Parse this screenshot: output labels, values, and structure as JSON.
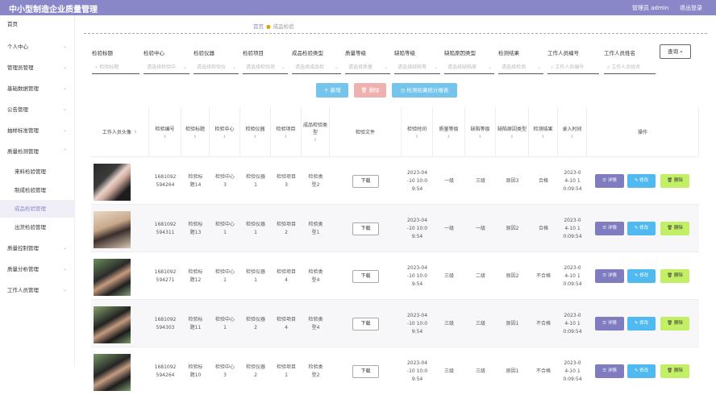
{
  "app": {
    "title": "中小型制造企业质量管理",
    "user": "管理员 admin",
    "logout": "退出登录"
  },
  "sidebar": {
    "items": [
      {
        "label": "首页",
        "chev": ""
      },
      {
        "label": "个人中心",
        "chev": "⌄"
      },
      {
        "label": "管理员管理",
        "chev": "⌄"
      },
      {
        "label": "基础数据管理",
        "chev": "⌄"
      },
      {
        "label": "公告管理",
        "chev": "⌄"
      },
      {
        "label": "抽样标准管理",
        "chev": "⌄"
      },
      {
        "label": "质量检测管理",
        "chev": "⌃"
      },
      {
        "label": "来料检验管理",
        "chev": ""
      },
      {
        "label": "制成检验管理",
        "chev": ""
      },
      {
        "label": "成品检验管理",
        "chev": ""
      },
      {
        "label": "出货检验管理",
        "chev": ""
      },
      {
        "label": "质量控制管理",
        "chev": "⌄"
      },
      {
        "label": "质量分析管理",
        "chev": "⌄"
      },
      {
        "label": "工作人员管理",
        "chev": "⌄"
      }
    ]
  },
  "breadcrumb": {
    "home": "首页",
    "sep": "●",
    "current": "成品检验"
  },
  "filters": {
    "labels": [
      "检验标题",
      "检验中心",
      "检验仪器",
      "检验项目",
      "成品检验类型",
      "质量等级",
      "缺陷等级",
      "缺陷原因类型",
      "检测结果",
      "工作人员编号",
      "工作人员姓名"
    ],
    "inputs": [
      {
        "ph": "⌕ 检验标题",
        "dd": ""
      },
      {
        "ph": "请选择检验中",
        "dd": "⌄"
      },
      {
        "ph": "请选择检验仪",
        "dd": "⌄"
      },
      {
        "ph": "请选择检验项",
        "dd": "⌄"
      },
      {
        "ph": "请选择成品检",
        "dd": "⌄"
      },
      {
        "ph": "请选择质量",
        "dd": "⌄"
      },
      {
        "ph": "请选择缺陷等",
        "dd": "⌄"
      },
      {
        "ph": "请选择缺陷原",
        "dd": "⌄"
      },
      {
        "ph": "请选择检测",
        "dd": "⌄"
      },
      {
        "ph": "⌕ 工作人员编号",
        "dd": ""
      },
      {
        "ph": "⌕ 工作人员姓名",
        "dd": ""
      }
    ],
    "query": "查询 ⌕"
  },
  "actions": {
    "add": "＋ 新增",
    "del": "🗑 删除",
    "report": "◷ 检测结果统计报表"
  },
  "table": {
    "headers": [
      "工作人员头像",
      "检验编号",
      "检验标题",
      "检验中心",
      "检验仪器",
      "检验项目",
      "成品检验类型",
      "检验文件",
      "检验时间",
      "质量等级",
      "缺陷等级",
      "缺陷原因类型",
      "检测结果",
      "录入时间",
      "操作"
    ],
    "sort": "⇕",
    "download": "下载",
    "ops": {
      "view": "☰ 详情",
      "edit": "✎ 修改",
      "del": "🗑 删除"
    },
    "rows": [
      {
        "id": "1681092594264",
        "title": "检验标题14",
        "center": "检验中心3",
        "instr": "检验仪器1",
        "item": "检验项目3",
        "type": "检验类型2",
        "time": "2023-04-10 10:09:54",
        "quality": "一级",
        "defect": "三级",
        "reason": "原因3",
        "result": "合格",
        "entry": "2023-04-10 10:09:54"
      },
      {
        "id": "1681092594311",
        "title": "检验标题13",
        "center": "检验中心1",
        "instr": "检验仪器1",
        "item": "检验项目2",
        "type": "检验类型1",
        "time": "2023-04-10 10:09:54",
        "quality": "一级",
        "defect": "一级",
        "reason": "原因2",
        "result": "合格",
        "entry": "2023-04-10 10:09:54"
      },
      {
        "id": "1681092594271",
        "title": "检验标题12",
        "center": "检验中心1",
        "instr": "检验仪器1",
        "item": "检验项目4",
        "type": "检验类型4",
        "time": "2023-04-10 10:09:54",
        "quality": "三级",
        "defect": "二级",
        "reason": "原因2",
        "result": "不合格",
        "entry": "2023-04-10 10:09:54"
      },
      {
        "id": "1681092594303",
        "title": "检验标题11",
        "center": "检验中心1",
        "instr": "检验仪器2",
        "item": "检验项目4",
        "type": "检验类型4",
        "time": "2023-04-10 10:09:54",
        "quality": "三级",
        "defect": "三级",
        "reason": "原因1",
        "result": "不合格",
        "entry": "2023-04-10 10:09:54"
      },
      {
        "id": "1681092594264",
        "title": "检验标题10",
        "center": "检验中心3",
        "instr": "检验仪器2",
        "item": "检验项目1",
        "type": "检验类型2",
        "time": "2023-04-10 10:09:54",
        "quality": "三级",
        "defect": "三级",
        "reason": "原因1",
        "result": "不合格",
        "entry": "2023-04-10 10:09:54"
      }
    ]
  },
  "colors": {
    "accent": "#8a87c9",
    "edit": "#4fb9f0",
    "del": "#c2ef66"
  }
}
